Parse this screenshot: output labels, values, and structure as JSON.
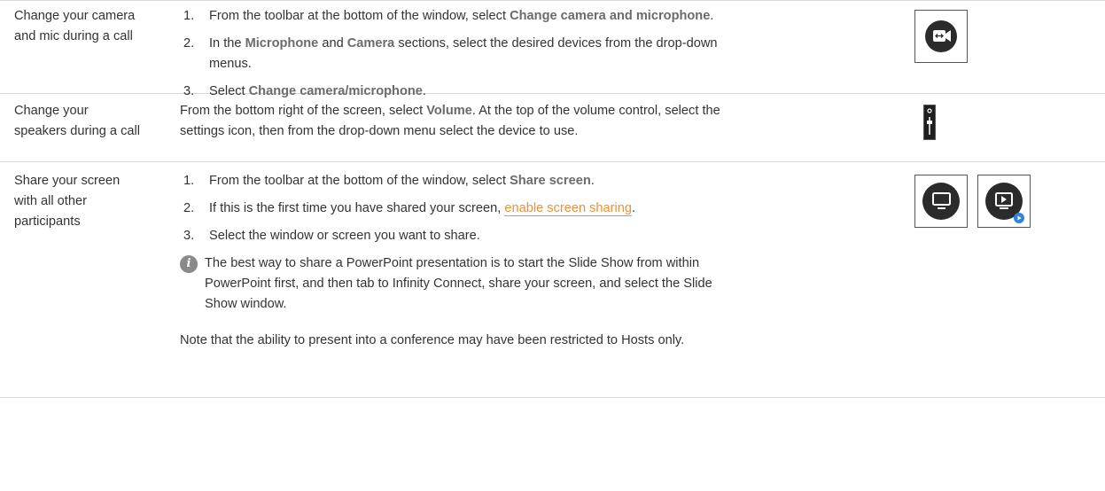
{
  "rows": [
    {
      "label": "Change your camera and mic during a call",
      "steps": [
        {
          "n": "1.",
          "pre": "From the toolbar at the bottom of the window, select ",
          "b1": "Change camera and microphone",
          "post": "."
        },
        {
          "n": "2.",
          "pre": "In the ",
          "b1": "Microphone",
          "mid": " and ",
          "b2": "Camera",
          "post": " sections, select the desired devices from the drop-down menus."
        },
        {
          "n": "3.",
          "pre": "Select ",
          "b1": "Change camera/microphone",
          "post": "."
        }
      ],
      "icon": "camera-swap-icon"
    },
    {
      "label": "Change your speakers during a call",
      "text_pre": "From the bottom right of the screen, select ",
      "text_bold": "Volume",
      "text_post": ". At the top of the volume control, select the settings icon, then from the drop-down menu select the device to use.",
      "icon": "volume-slider-icon"
    },
    {
      "label": "Share your screen with all other participants",
      "steps": [
        {
          "n": "1.",
          "pre": "From the toolbar at the bottom of the window, select ",
          "b1": "Share screen",
          "post": "."
        },
        {
          "n": "2.",
          "pre": "If this is the first time you have shared your screen, ",
          "link": "enable screen sharing",
          "post": "."
        },
        {
          "n": "3.",
          "pre": "Select the window or screen you want to share."
        }
      ],
      "note": "The best way to share a PowerPoint presentation is to start the Slide Show from within PowerPoint first, and then tab to Infinity Connect, share your screen, and select the Slide Show window.",
      "note_icon": "i",
      "plain": "Note that the ability to present into a conference may have been restricted to Hosts only.",
      "icons": [
        "monitor-icon",
        "presentation-play-icon"
      ]
    }
  ],
  "colors": {
    "link": "#e8923a",
    "icon_bg": "#2b2b2b",
    "badge": "#2f86d6"
  }
}
